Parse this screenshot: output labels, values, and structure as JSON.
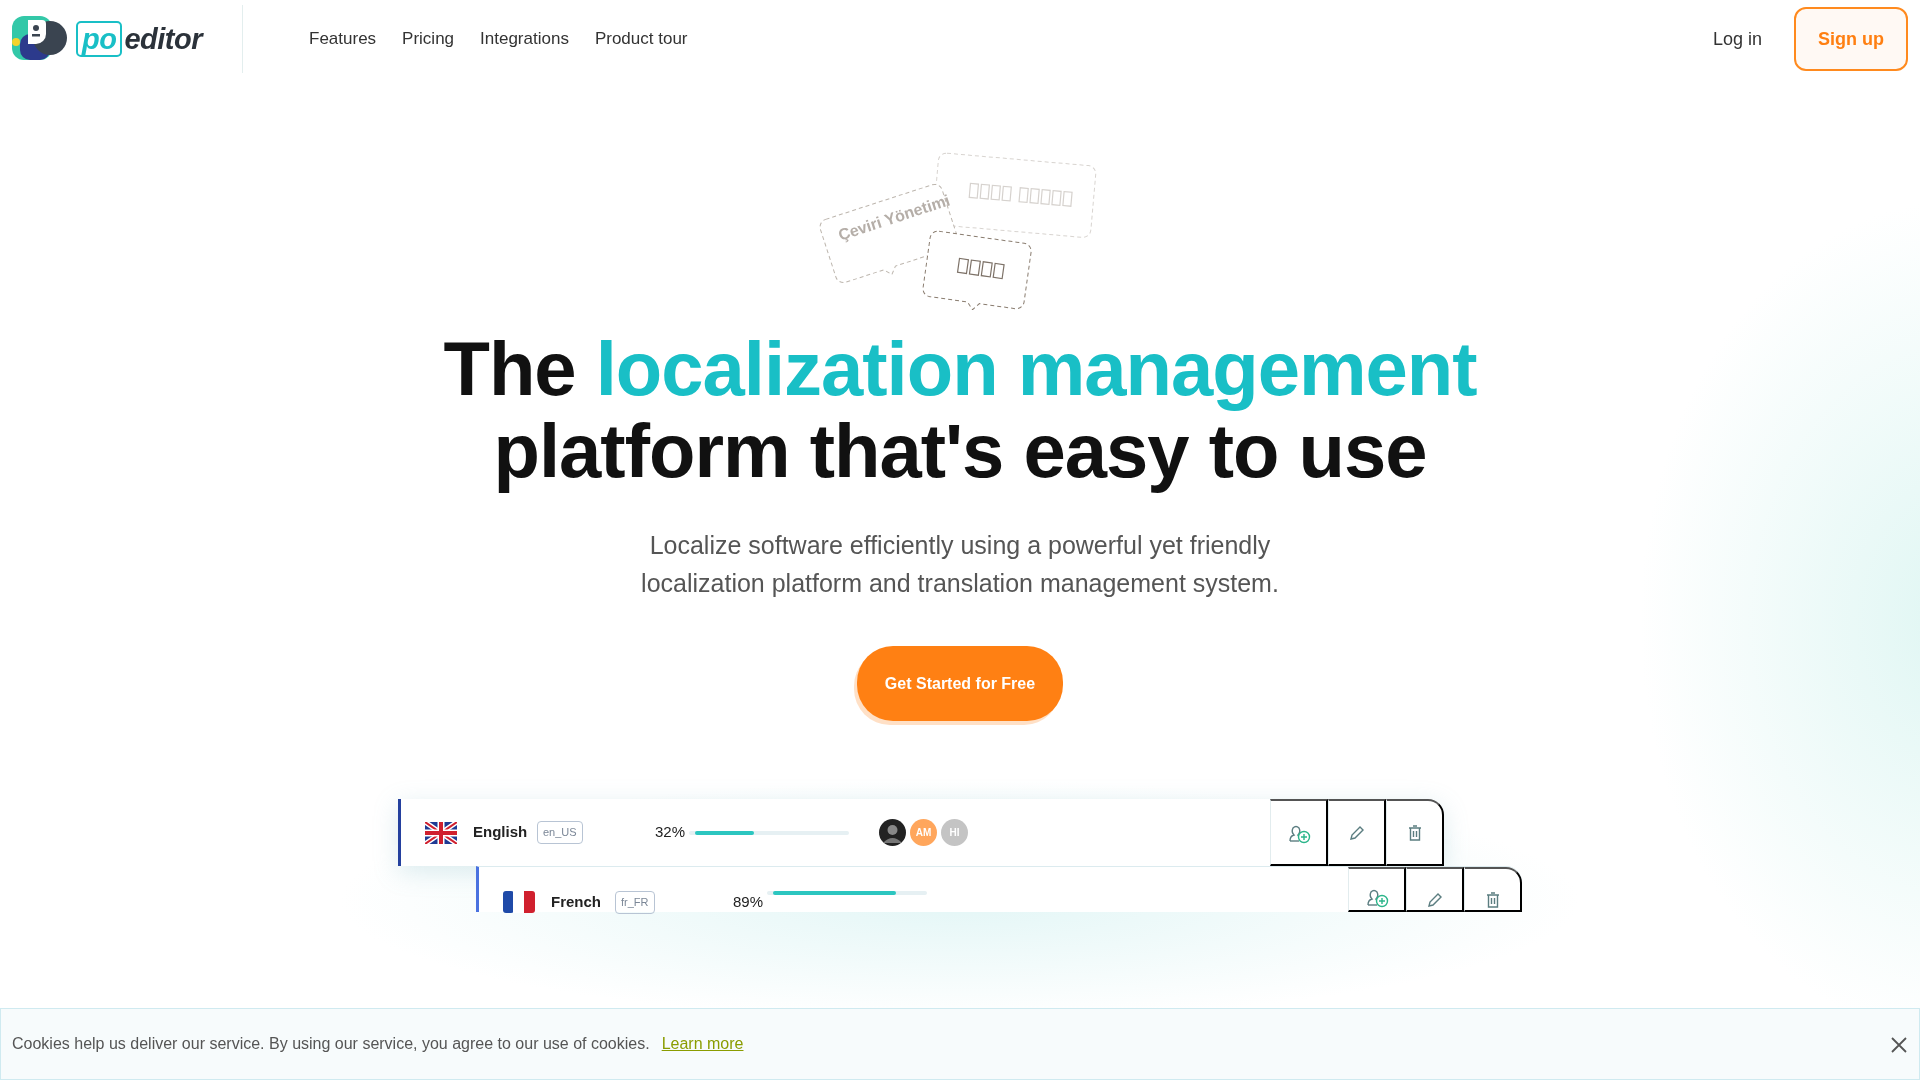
{
  "header": {
    "logo": [
      {
        "text": "po",
        "accent": true
      },
      {
        "text": "editor",
        "accent": false
      }
    ],
    "nav": [
      "Features",
      "Pricing",
      "Integrations",
      "Product tour"
    ],
    "login": "Log in",
    "signup": "Sign up"
  },
  "illustration": {
    "bubble_text": "Çeviri Yönetimi"
  },
  "hero": {
    "headline": [
      {
        "text": "The ",
        "accent": false
      },
      {
        "text": "localization management",
        "accent": true
      },
      {
        "text": " platform that's easy to use",
        "accent": false
      }
    ],
    "subtitle": "Localize software efficiently using a powerful yet friendly localization platform and translation management system.",
    "cta": "Get Started for Free"
  },
  "languages": [
    {
      "kind": "gb",
      "name": "English",
      "code": "en_US",
      "percent": "32%",
      "level": 0.4,
      "avatars": [
        {
          "kind": "photo",
          "color": "#222222"
        },
        {
          "kind": "initials",
          "text": "AM",
          "color": "#ffa65c"
        },
        {
          "kind": "initials",
          "text": "HI",
          "color": "#c4c4c4"
        }
      ]
    },
    {
      "kind": "fr",
      "name": "French",
      "code": "fr_FR",
      "percent": "89%",
      "level": 0.83
    }
  ],
  "cookie": {
    "text": "Cookies help us deliver our service. By using our service, you agree to our use of cookies.",
    "link": "Learn more"
  }
}
